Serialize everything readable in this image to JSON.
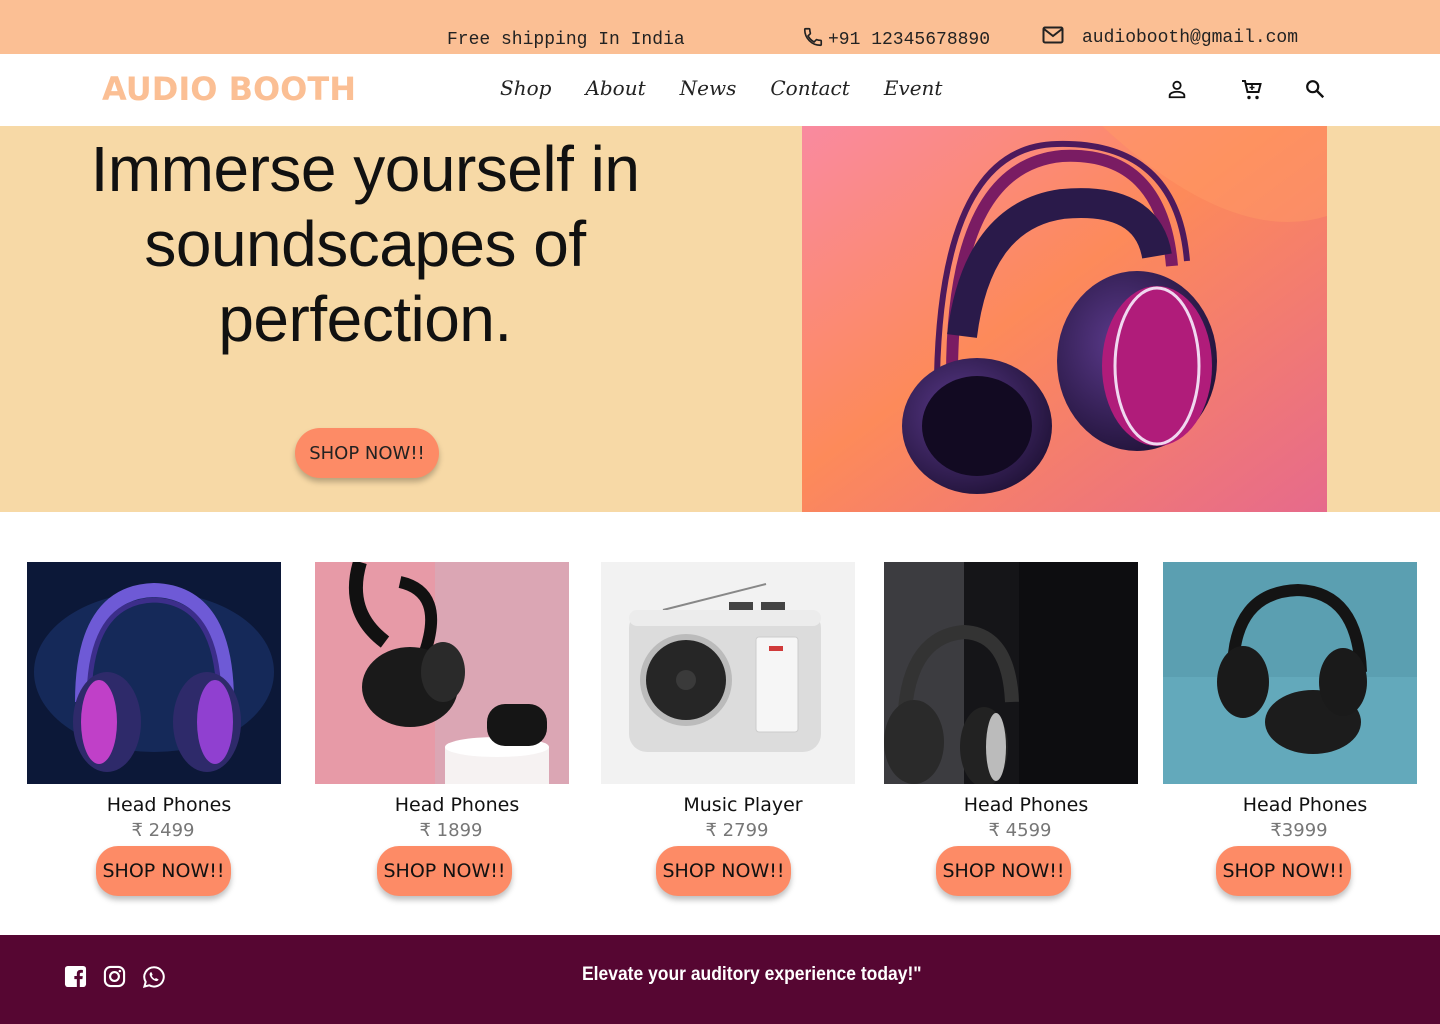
{
  "topbar": {
    "shipping": "Free shipping In India",
    "phone": "+91 12345678890",
    "email": "audiobooth@gmail.com",
    "phone_icon": "phone-icon",
    "email_icon": "mail-icon"
  },
  "nav": {
    "logo": "AUDIO BOOTH",
    "links": [
      "Shop",
      "About",
      "News",
      "Contact",
      "Event"
    ],
    "icons": [
      "user-icon",
      "cart-icon",
      "search-icon"
    ]
  },
  "hero": {
    "headline": "Immerse yourself in soundscapes of perfection.",
    "cta": "SHOP NOW!!",
    "image": "headphones-product-photo"
  },
  "products": [
    {
      "name": "Head Phones",
      "price": "₹ 2499",
      "cta": "SHOP NOW!!",
      "image": "purple-headphones-photo"
    },
    {
      "name": "Head Phones",
      "price": "₹ 1899",
      "cta": "SHOP NOW!!",
      "image": "black-headphones-earbuds-photo"
    },
    {
      "name": "Music Player",
      "price": "₹ 2799",
      "cta": "SHOP NOW!!",
      "image": "radio-player-photo"
    },
    {
      "name": "Head Phones",
      "price": "₹ 4599",
      "cta": "SHOP NOW!!",
      "image": "silver-headphones-photo"
    },
    {
      "name": "Head Phones",
      "price": "₹3999",
      "cta": "SHOP NOW!!",
      "image": "black-headphones-teal-photo"
    }
  ],
  "footer": {
    "tagline": "Elevate your auditory experience today!\"",
    "social_icons": [
      "facebook-icon",
      "instagram-icon",
      "whatsapp-icon"
    ]
  },
  "colors": {
    "topbar": "#fbbf94",
    "logo": "#fbbf94",
    "hero_bg": "#f7d9a6",
    "button": "#fd8b66",
    "footer": "#560632"
  }
}
